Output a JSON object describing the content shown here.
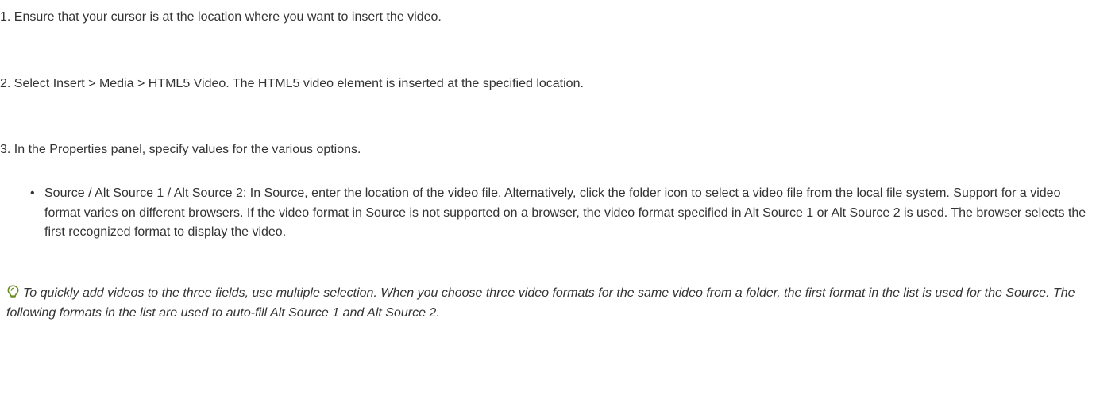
{
  "steps": [
    {
      "text": "1.  Ensure that your cursor is at the location where you want to insert the video."
    },
    {
      "text": "2.  Select Insert > Media > HTML5 Video. The HTML5 video element is inserted at the specified location."
    },
    {
      "text": "3.  In the Properties panel, specify values for the various options."
    }
  ],
  "options": [
    {
      "bullet": "•",
      "text": "Source / Alt Source 1 / Alt Source 2: In Source, enter the location of the video file. Alternatively, click the folder icon to select a video file from the local file system. Support for a video format varies on different browsers. If the video format in Source is not supported on a browser, the video format specified in Alt Source 1 or Alt Source 2 is used. The browser selects the first recognized format to display the video."
    }
  ],
  "tip": {
    "icon": "lightbulb-icon",
    "icon_color": "#6b8e23",
    "text": "To quickly add videos to the three fields, use multiple selection. When you choose three video formats for the same video from a folder, the first format in the list is used for the Source. The following formats in the list are used to auto-fill Alt Source 1 and Alt Source 2."
  }
}
